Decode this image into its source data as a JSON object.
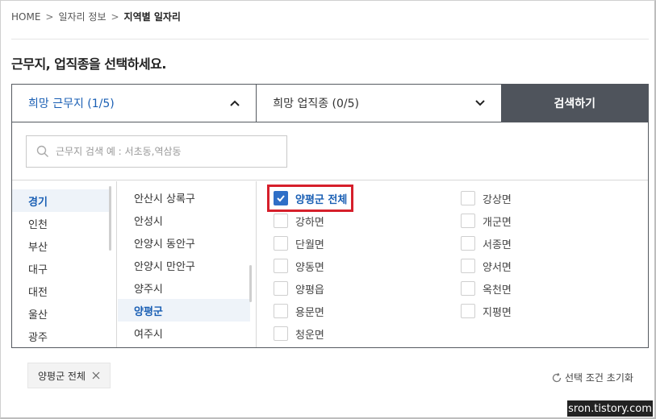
{
  "breadcrumb": {
    "home": "HOME",
    "sep1": ">",
    "section": "일자리 정보",
    "sep2": ">",
    "current": "지역별 일자리"
  },
  "page_title": "근무지, 업직종을 선택하세요.",
  "tabs": {
    "region_label": "희망 근무지 (1/5)",
    "region_icon": "chevron-up-icon",
    "job_label": "희망 업직종 (0/5)",
    "job_icon": "chevron-down-icon",
    "search_button": "검색하기"
  },
  "search": {
    "placeholder": "근무지 검색 예 : 서초동,역삼동",
    "icon": "search-icon"
  },
  "sido_list": [
    "경기",
    "인천",
    "부산",
    "대구",
    "대전",
    "울산",
    "광주"
  ],
  "sido_selected": "경기",
  "sigungu_list": [
    "안산시 상록구",
    "안성시",
    "안양시 동안구",
    "안양시 만안구",
    "양주시",
    "양평군",
    "여주시"
  ],
  "sigungu_selected": "양평군",
  "towns_left": [
    {
      "label": "양평군 전체",
      "checked": true
    },
    {
      "label": "강하면",
      "checked": false
    },
    {
      "label": "단월면",
      "checked": false
    },
    {
      "label": "양동면",
      "checked": false
    },
    {
      "label": "양평읍",
      "checked": false
    },
    {
      "label": "용문면",
      "checked": false
    },
    {
      "label": "청운면",
      "checked": false
    }
  ],
  "towns_right": [
    {
      "label": "강상면",
      "checked": false
    },
    {
      "label": "개군면",
      "checked": false
    },
    {
      "label": "서종면",
      "checked": false
    },
    {
      "label": "양서면",
      "checked": false
    },
    {
      "label": "옥천면",
      "checked": false
    },
    {
      "label": "지평면",
      "checked": false
    }
  ],
  "selected_chip": "양평군 전체",
  "reset_label": "선택 조건 초기화",
  "watermark": "sron.tistory.com",
  "colors": {
    "accent": "#1a5fb4",
    "checkbox_fill": "#2f6fc7",
    "search_button_bg": "#4f545c",
    "highlight_border": "#d61f2b"
  }
}
